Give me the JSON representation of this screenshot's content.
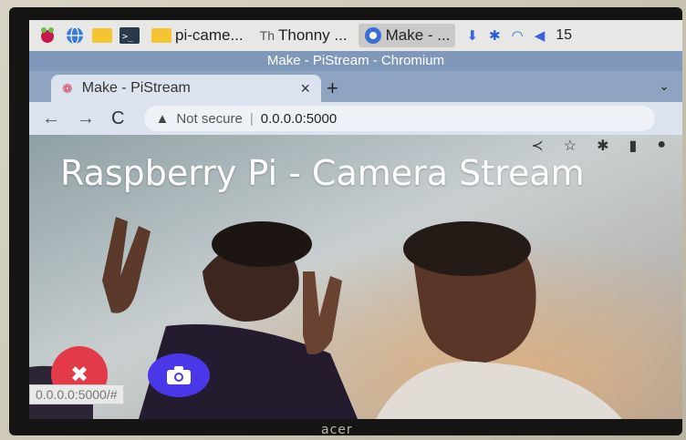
{
  "taskbar": {
    "items": [
      {
        "label": "pi-came...",
        "icon": "folder-icon"
      },
      {
        "label": "Thonny ...",
        "icon": "thonny-icon"
      },
      {
        "label": "Make - ...",
        "icon": "chromium-icon"
      }
    ],
    "clock": "15"
  },
  "window": {
    "title": "Make - PiStream - Chromium"
  },
  "tab": {
    "title": "Make - PiStream"
  },
  "omnibox": {
    "security": "Not secure",
    "separator": "|",
    "url": "0.0.0.0:5000"
  },
  "page": {
    "heading": "Raspberry Pi - Camera Stream",
    "stop_icon": "close-icon",
    "snap_icon": "camera-icon"
  },
  "status": {
    "hover_url": "0.0.0.0:5000/#"
  },
  "monitor": {
    "brand": "acer"
  },
  "colors": {
    "stop": "#e33a49",
    "snapshot": "#4a37e8",
    "titlebar": "#7f97b8"
  }
}
